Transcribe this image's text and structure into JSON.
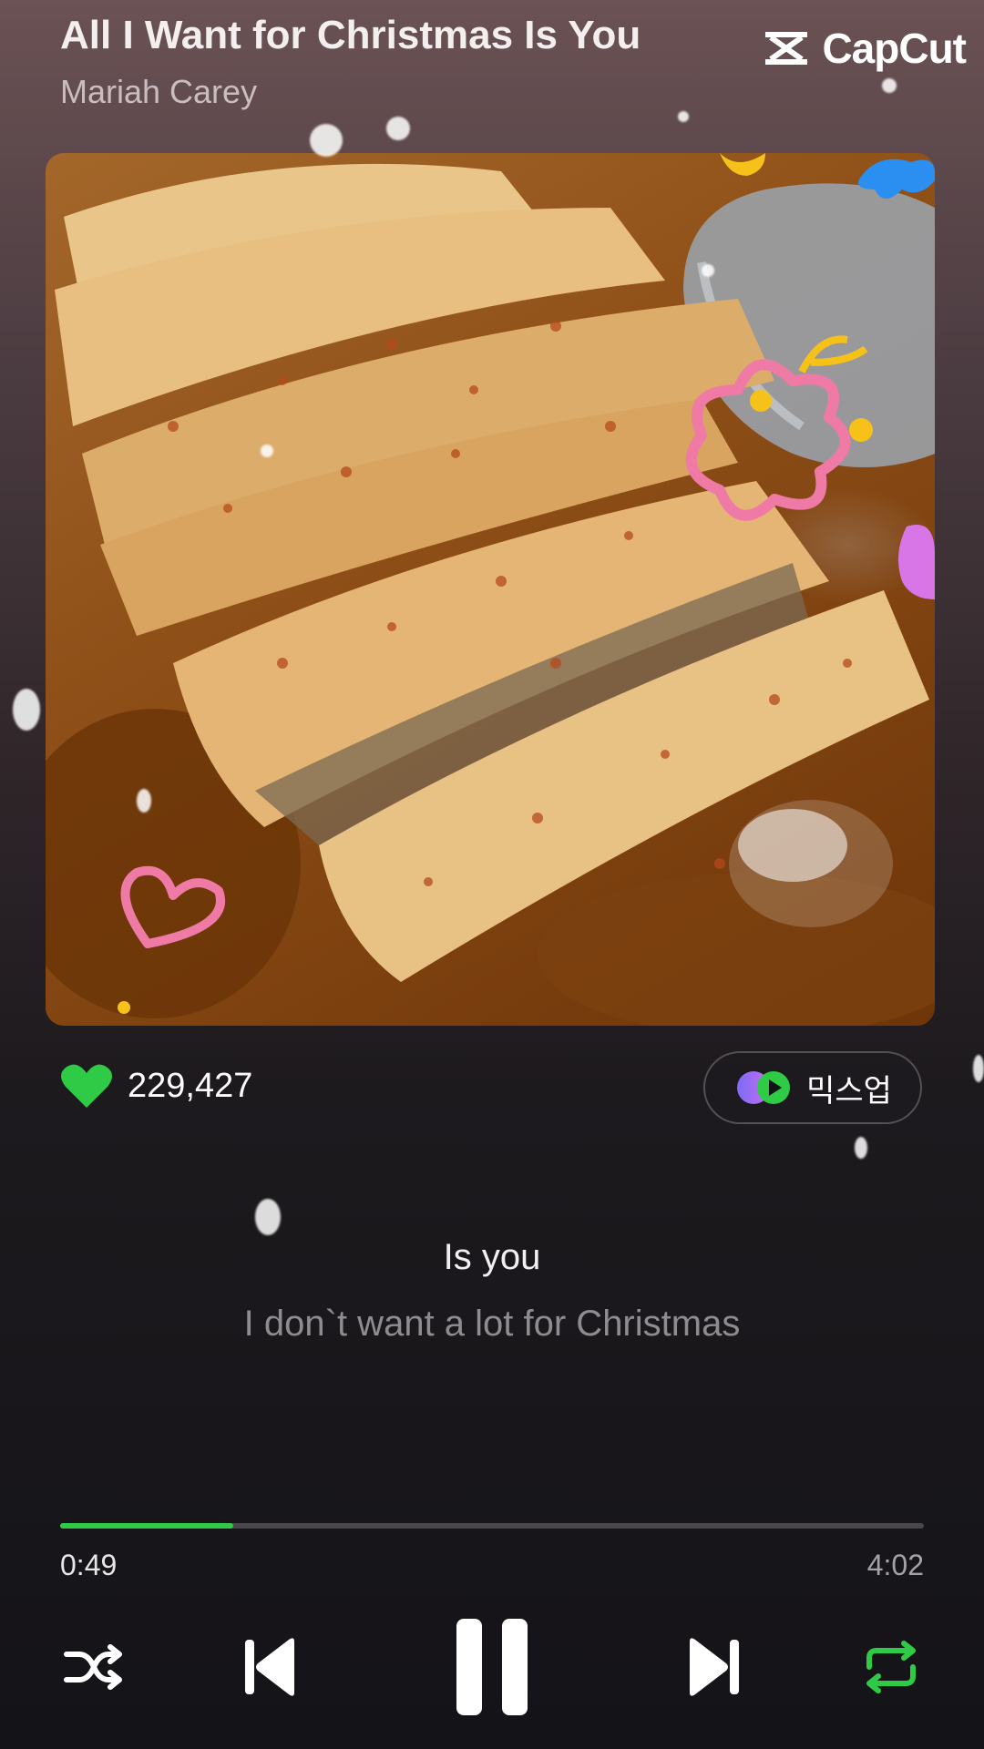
{
  "track": {
    "title": "All I Want for Christmas Is You",
    "artist": "Mariah Carey"
  },
  "watermark": {
    "text": "CapCut",
    "icon": "capcut-logo-icon"
  },
  "album_art": {
    "description_icon": "album-art-image"
  },
  "likes": {
    "count": "229,427",
    "icon": "heart-icon",
    "color": "#2fcb47"
  },
  "mixup_button": {
    "label": "믹스업",
    "icon": "mixup-icon"
  },
  "lyrics": {
    "current": "Is you",
    "next": "I don`t want a lot for Christmas"
  },
  "progress": {
    "current_time": "0:49",
    "total_time": "4:02",
    "fraction": 0.2,
    "fill_color": "#2fcb47"
  },
  "controls": {
    "shuffle": "shuffle-icon",
    "previous": "previous-icon",
    "play_pause": "pause-icon",
    "next": "next-icon",
    "repeat": "repeat-icon",
    "repeat_active_color": "#2fcb47"
  }
}
